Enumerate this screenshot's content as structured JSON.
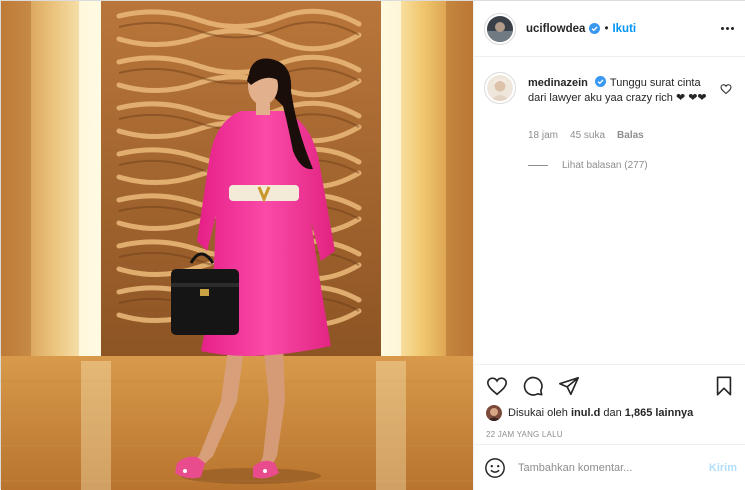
{
  "header": {
    "username": "uciflowdea",
    "dot": "•",
    "follow_label": "Ikuti",
    "more_icon": "more-horizontal-icon"
  },
  "comment": {
    "username": "medinazein",
    "text": "Tunggu surat cinta dari lawyer aku yaa crazy rich ❤ ❤❤",
    "time": "18 jam",
    "likes": "45 suka",
    "reply_label": "Balas",
    "view_replies": "Lihat balasan (277)"
  },
  "actions": {
    "liked_by_prefix": "Disukai oleh",
    "liked_by_user": "inul.d",
    "liked_by_and": "dan",
    "liked_by_count": "1,865 lainnya",
    "timestamp": "22 JAM YANG LALU"
  },
  "add_comment": {
    "placeholder": "Tambahkan komentar...",
    "post_label": "Kirim"
  },
  "colors": {
    "accent": "#0095f6",
    "verified": "#3897f0",
    "dress": "#f2379a",
    "muted_text": "#8e8e8e"
  }
}
